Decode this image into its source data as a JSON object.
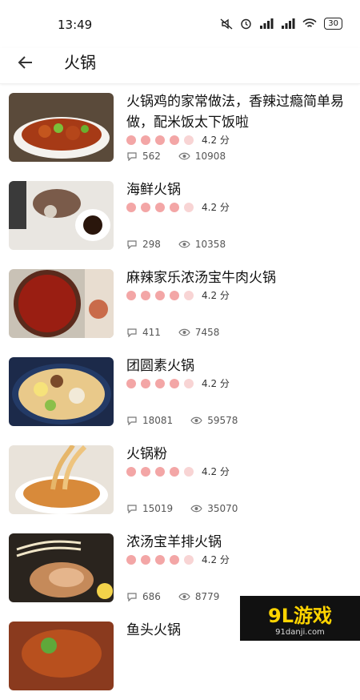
{
  "status": {
    "time": "13:49",
    "battery": "30"
  },
  "header": {
    "title": "火锅"
  },
  "items": [
    {
      "name": "火锅鸡的家常做法，香辣过瘾简单易做，配米饭太下饭啦",
      "score": "4.2 分",
      "likes": "562",
      "views": "10908"
    },
    {
      "name": "海鲜火锅",
      "score": "4.2 分",
      "likes": "298",
      "views": "10358"
    },
    {
      "name": "麻辣家乐浓汤宝牛肉火锅",
      "score": "4.2 分",
      "likes": "411",
      "views": "7458"
    },
    {
      "name": "团圆素火锅",
      "score": "4.2 分",
      "likes": "18081",
      "views": "59578"
    },
    {
      "name": "火锅粉",
      "score": "4.2 分",
      "likes": "15019",
      "views": "35070"
    },
    {
      "name": "浓汤宝羊排火锅",
      "score": "4.2 分",
      "likes": "686",
      "views": "8779"
    },
    {
      "name": "鱼头火锅",
      "score": "",
      "likes": "",
      "views": ""
    }
  ],
  "watermark": {
    "logo": "9L游戏",
    "site": "91danji.com"
  }
}
